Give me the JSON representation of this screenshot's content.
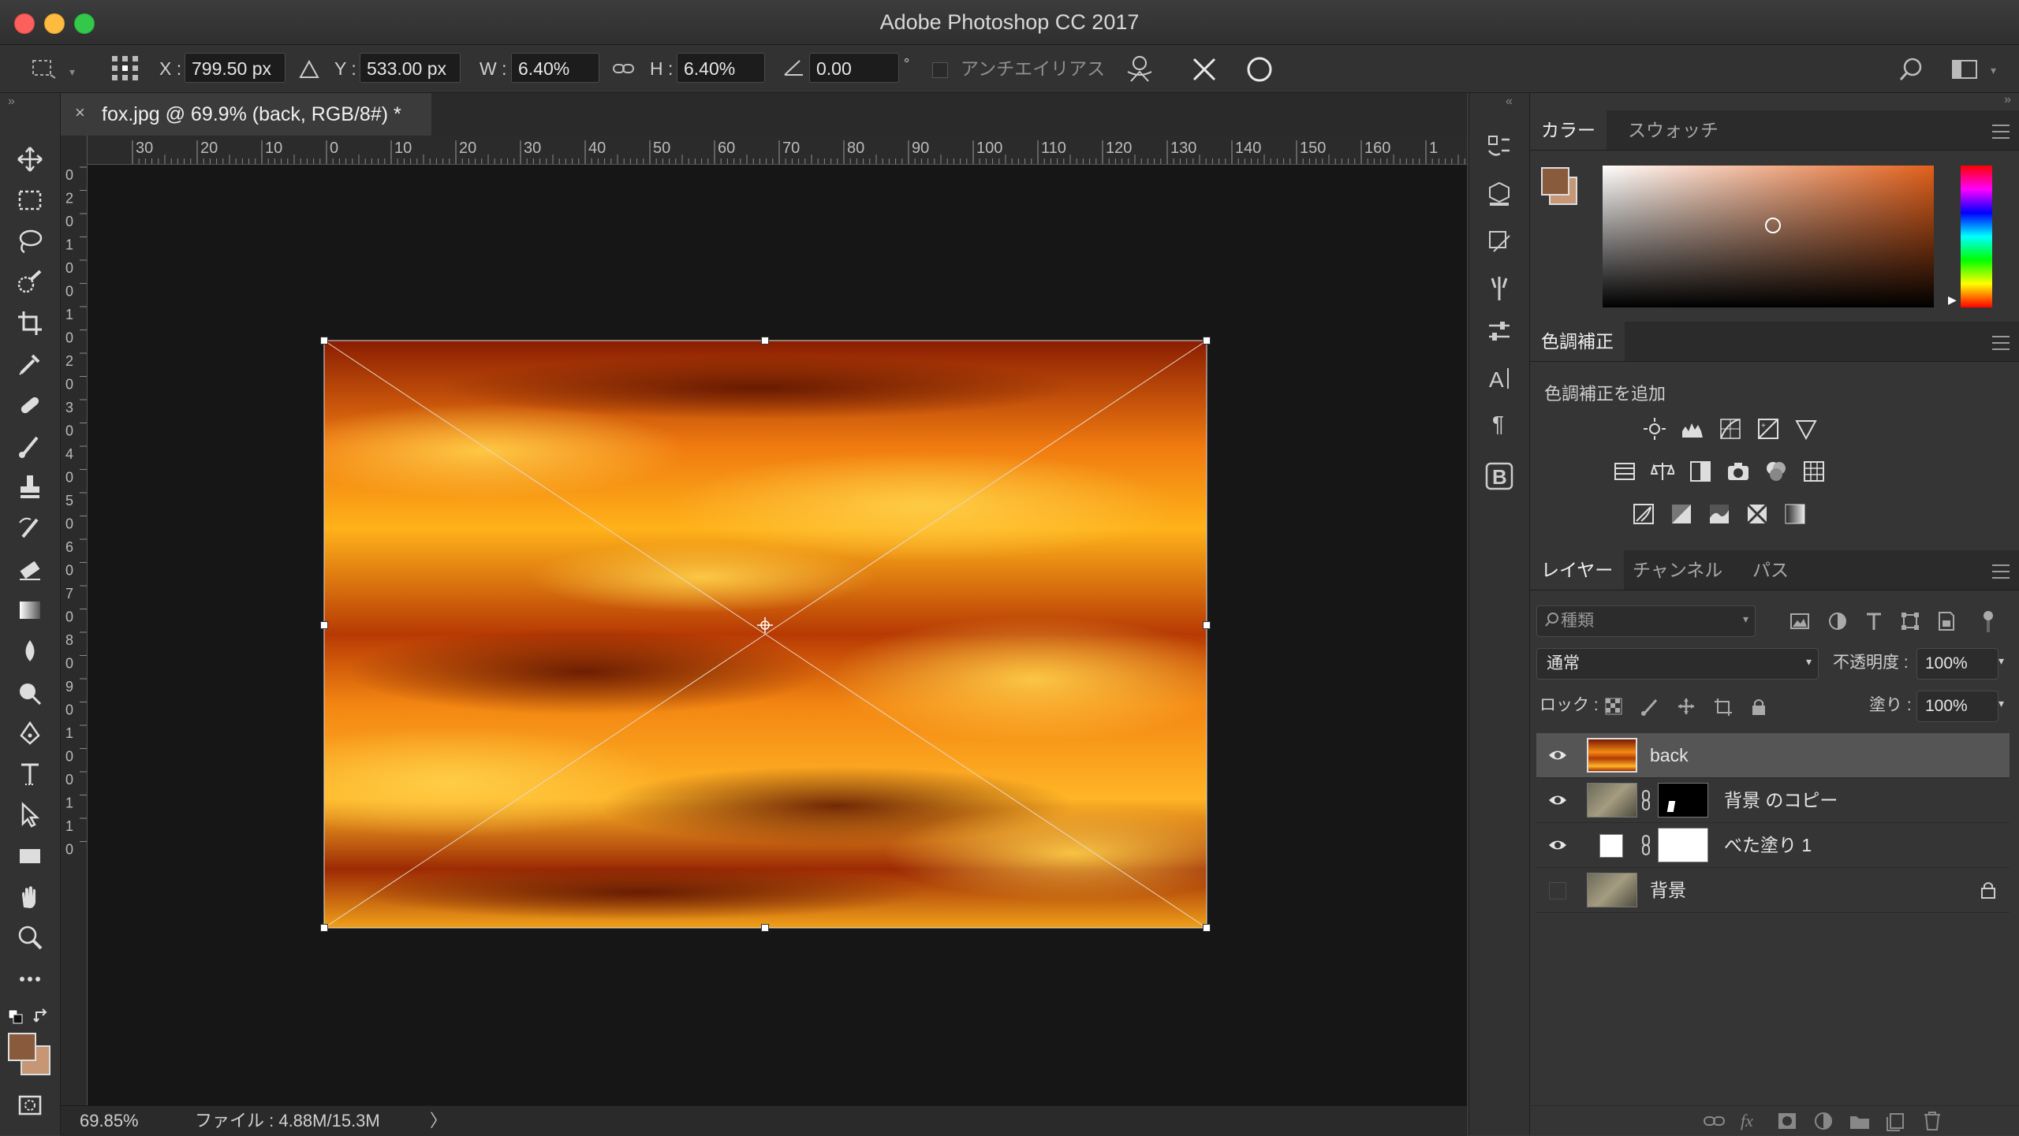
{
  "window": {
    "title": "Adobe Photoshop CC 2017"
  },
  "options": {
    "x_label": "X :",
    "x_value": "799.50 px",
    "y_label": "Y :",
    "y_value": "533.00 px",
    "w_label": "W :",
    "w_value": "6.40%",
    "h_label": "H :",
    "h_value": "6.40%",
    "angle_value": "0.00",
    "degree": "°",
    "antialias_label": "アンチエイリアス"
  },
  "document": {
    "tab_title": "fox.jpg @ 69.9% (back, RGB/8#) *",
    "hruler_ticks": [
      "30",
      "20",
      "10",
      "0",
      "10",
      "20",
      "30",
      "40",
      "50",
      "60",
      "70",
      "80",
      "90",
      "100",
      "110",
      "120",
      "130",
      "140",
      "150",
      "160",
      "1"
    ],
    "vruler_ticks": [
      "0",
      "2",
      "0",
      "1",
      "0",
      "0",
      "1",
      "0",
      "2",
      "0",
      "3",
      "0",
      "4",
      "0",
      "5",
      "0",
      "6",
      "0",
      "7",
      "0",
      "8",
      "0",
      "9",
      "0",
      "1",
      "0",
      "0",
      "1",
      "1",
      "0"
    ]
  },
  "status": {
    "zoom": "69.85%",
    "file_info": "ファイル : 4.88M/15.3M",
    "arrow": "〉"
  },
  "color_panel": {
    "tabs": [
      "カラー",
      "スウォッチ"
    ],
    "foreground": "#8a5a3c",
    "background": "#c79674"
  },
  "adjustments_panel": {
    "tab": "色調補正",
    "title": "色調補正を追加"
  },
  "layers_panel": {
    "tabs": [
      "レイヤー",
      "チャンネル",
      "パス"
    ],
    "filter_placeholder": "種類",
    "blend_mode": "通常",
    "opacity_label": "不透明度 :",
    "opacity_value": "100%",
    "lock_label": "ロック :",
    "fill_label": "塗り :",
    "fill_value": "100%",
    "layers": [
      {
        "name": "back",
        "visible": true,
        "selected": true
      },
      {
        "name": "背景 のコピー",
        "visible": true,
        "selected": false
      },
      {
        "name": "べた塗り 1",
        "visible": true,
        "selected": false
      },
      {
        "name": "背景",
        "visible": false,
        "selected": false,
        "locked": true
      }
    ]
  },
  "colors": {
    "accent_selected": "#555555",
    "canvas_bg": "#161616"
  }
}
